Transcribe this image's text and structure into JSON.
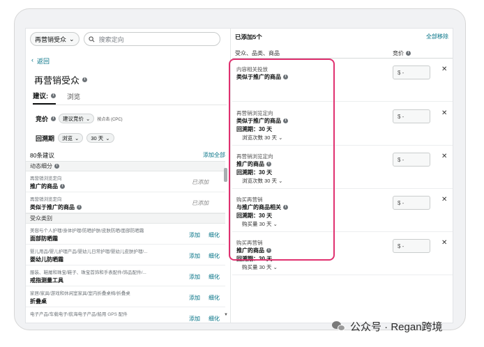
{
  "left": {
    "audience_select": "再营销受众",
    "search_placeholder": "搜索定向",
    "back": "返回",
    "title": "再营销受众",
    "tabs": [
      {
        "label": "建议:"
      },
      {
        "label": "浏览"
      }
    ],
    "bid_label": "竞价",
    "bid_select": "建议竞价",
    "bid_unit": "按点击 (CPC)",
    "lookback_label": "回溯期",
    "lookback_type": "浏览",
    "lookback_days": "30 天",
    "suggest_count": "80条建议",
    "add_all": "添加全部",
    "sections": [
      {
        "title": "动态细分",
        "items": [
          {
            "category": "再营销浏览定向",
            "name": "推广的商品",
            "status": "已添加"
          },
          {
            "category": "再营销浏览定向",
            "name": "类似于推广的商品",
            "status": "已添加"
          }
        ]
      },
      {
        "title": "受众类别",
        "items": [
          {
            "category": "美容与个人护理/身体护理/防晒护肤/皮肤防晒/面部防晒霜",
            "name": "面部防晒霜",
            "add": "添加",
            "refine": "细化"
          },
          {
            "category": "婴儿用品/婴儿护理产品/婴幼儿日常护理/婴幼儿皮肤护理/...",
            "name": "婴幼儿防晒霜",
            "add": "添加",
            "refine": "细化"
          },
          {
            "category": "服装、鞋履和珠宝/鞋子、珠宝首饰和手表配件/饰品配件/...",
            "name": "戒指测量工具",
            "add": "添加",
            "refine": "细化"
          },
          {
            "category": "家居/家具/游戏和休闲室家具/室内折叠桌椅/折叠桌",
            "name": "折叠桌",
            "add": "添加",
            "refine": "细化"
          },
          {
            "category": "电子产品/车载电子/航海电子产品/船用 GPS 配件",
            "name": "",
            "add": "添加",
            "refine": "细化"
          }
        ]
      }
    ]
  },
  "right": {
    "added_title": "已添加5个",
    "remove_all": "全部移除",
    "col_target": "受众、品类、商品",
    "col_bid": "竞价",
    "targets": [
      {
        "type": "内容相关投放",
        "name": "类似于推广的商品",
        "lookback": "",
        "metric": ""
      },
      {
        "type": "再营销浏览定向",
        "name": "类似于推广的商品",
        "lookback": "回溯期：30 天",
        "metric": "浏览次数 30 天"
      },
      {
        "type": "再营销浏览定向",
        "name": "推广的商品",
        "lookback": "回溯期：30 天",
        "metric": "浏览次数 30 天"
      },
      {
        "type": "购买再营销",
        "name": "与推广的商品相关",
        "lookback": "回溯期：30 天",
        "metric": "购买量 30 天"
      },
      {
        "type": "购买再营销",
        "name": "推广的商品",
        "lookback": "回溯期：30 天",
        "metric": "购买量 30 天"
      }
    ],
    "bid_placeholder": "$  -"
  },
  "watermark": "公众号 · Regan跨境",
  "colors": {
    "accent_link": "#007185",
    "highlight": "#e0306f"
  }
}
